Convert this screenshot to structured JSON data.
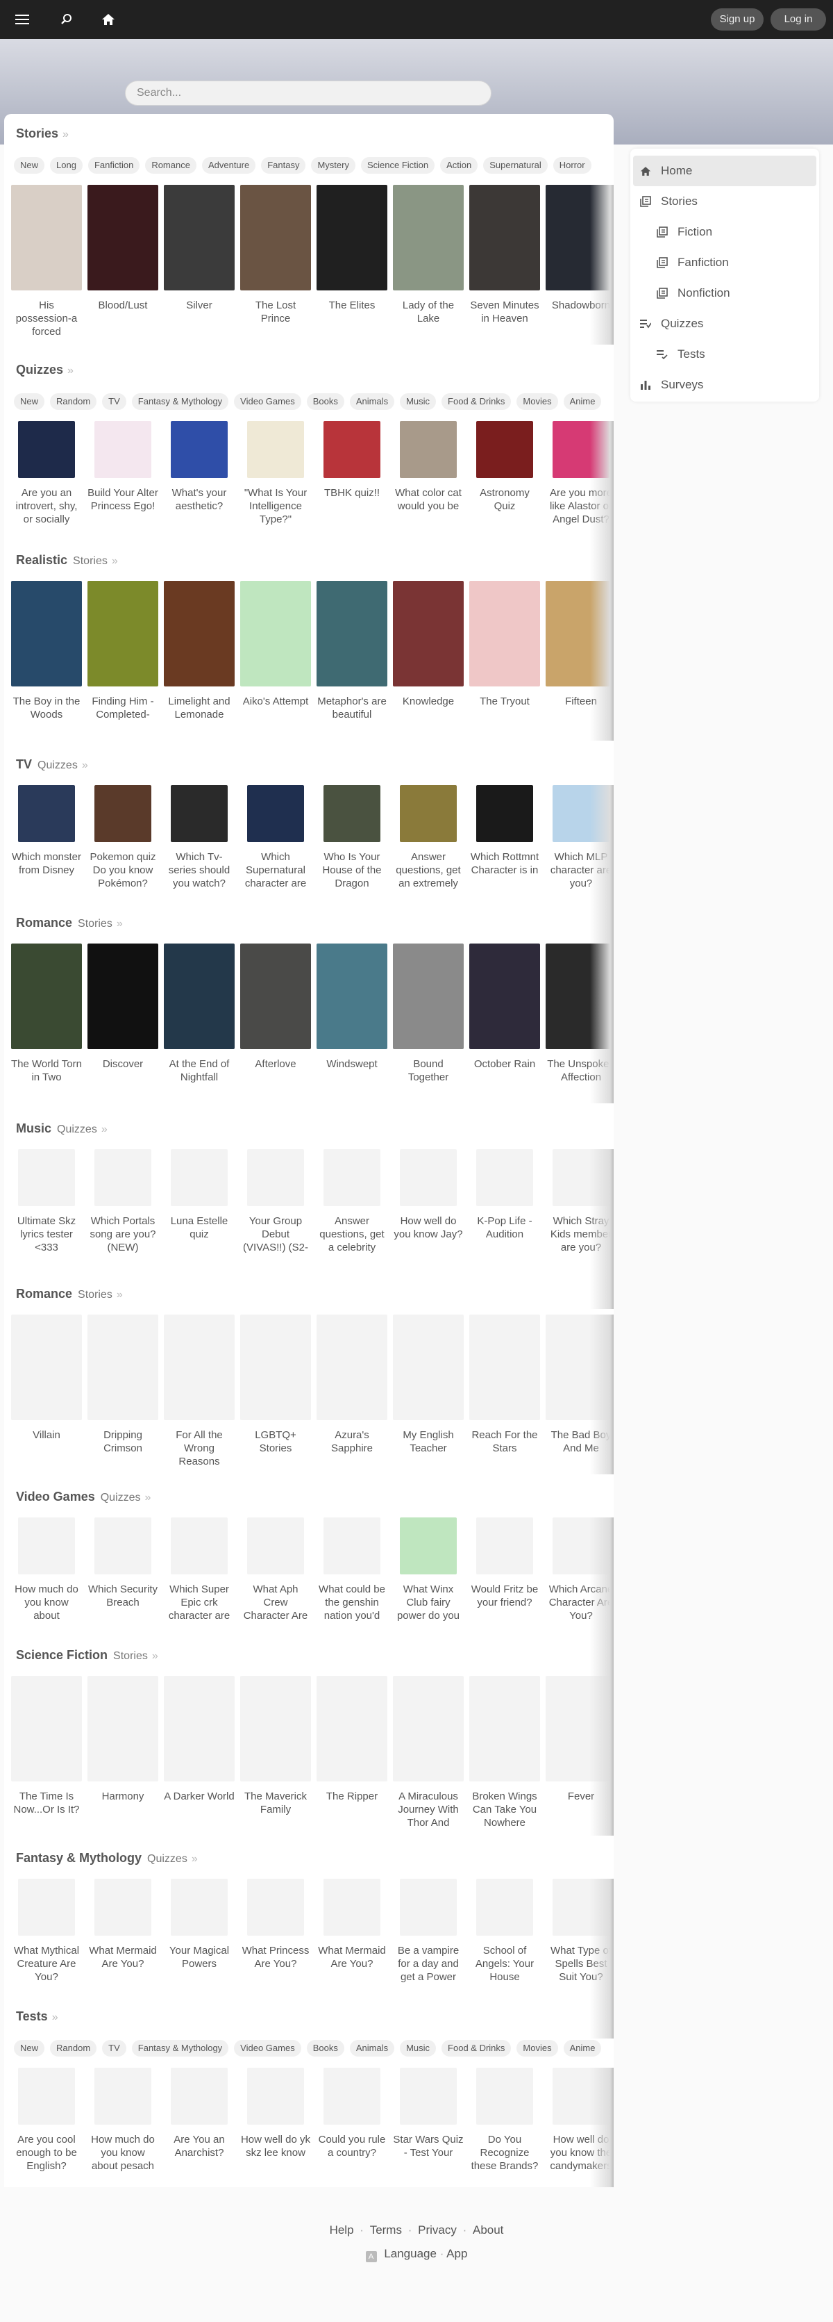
{
  "topbar": {
    "menu_icon": "hamburger-menu-icon",
    "search_icon": "search-icon",
    "home_icon": "home-icon",
    "signup_label": "Sign up",
    "login_label": "Log in"
  },
  "search": {
    "placeholder": "Search..."
  },
  "sections": [
    {
      "title": "Stories",
      "sub": "",
      "kind": "story",
      "chips": [
        "New",
        "Long",
        "Fanfiction",
        "Romance",
        "Adventure",
        "Fantasy",
        "Mystery",
        "Science Fiction",
        "Action",
        "Supernatural",
        "Horror"
      ],
      "items": [
        {
          "title": "His possession-a forced",
          "color": "#d9cfc6"
        },
        {
          "title": "Blood/Lust",
          "color": "#3a1a1d"
        },
        {
          "title": "Silver",
          "color": "#3b3b3b"
        },
        {
          "title": "The Lost Prince",
          "color": "#6a5443"
        },
        {
          "title": "The Elites",
          "color": "#202020"
        },
        {
          "title": "Lady of the Lake",
          "color": "#8a9684"
        },
        {
          "title": "Seven Minutes in Heaven",
          "color": "#3c3836"
        },
        {
          "title": "Shadowborn",
          "color": "#262a33"
        }
      ]
    },
    {
      "title": "Quizzes",
      "sub": "",
      "kind": "quiz",
      "chips": [
        "New",
        "Random",
        "TV",
        "Fantasy & Mythology",
        "Video Games",
        "Books",
        "Animals",
        "Music",
        "Food & Drinks",
        "Movies",
        "Anime"
      ],
      "items": [
        {
          "title": "Are you an introvert, shy, or socially",
          "color": "#1e2a4a"
        },
        {
          "title": "Build Your Alter Princess Ego!",
          "color": "#f4e7ef"
        },
        {
          "title": "What's your aesthetic?",
          "color": "#2f4ea8"
        },
        {
          "title": "\"What Is Your Intelligence Type?\"",
          "color": "#efe9d6"
        },
        {
          "title": "TBHK quiz!!",
          "color": "#b8343a"
        },
        {
          "title": "What color cat would you be",
          "color": "#a89a8a"
        },
        {
          "title": "Astronomy Quiz",
          "color": "#7a1e1e"
        },
        {
          "title": "Are you more like Alastor or Angel Dust?",
          "color": "#d63a74"
        }
      ]
    },
    {
      "title": "Realistic",
      "sub": "Stories",
      "kind": "story",
      "chips": [],
      "items": [
        {
          "title": "The Boy in the Woods",
          "color": "#274a6a"
        },
        {
          "title": "Finding Him - Completed-",
          "color": "#7c8a2a"
        },
        {
          "title": "Limelight and Lemonade",
          "color": "#6a3a22"
        },
        {
          "title": "Aiko's Attempt",
          "color": "#bfe6bf"
        },
        {
          "title": "Metaphor's are beautiful",
          "color": "#3f6a72"
        },
        {
          "title": "Knowledge",
          "color": "#7a3434"
        },
        {
          "title": "The Tryout",
          "color": "#efc7c7"
        },
        {
          "title": "Fifteen",
          "color": "#c9a46a"
        }
      ]
    },
    {
      "title": "TV",
      "sub": "Quizzes",
      "kind": "quiz",
      "chips": [],
      "items": [
        {
          "title": "Which monster from Disney",
          "color": "#2a3a5a"
        },
        {
          "title": "Pokemon quiz Do you know Pokémon?",
          "color": "#5a3a2a"
        },
        {
          "title": "Which Tv-series should you watch?",
          "color": "#2a2a2a"
        },
        {
          "title": "Which Supernatural character are",
          "color": "#1f2f4f"
        },
        {
          "title": "Who Is Your House of the Dragon",
          "color": "#4a5240"
        },
        {
          "title": "Answer questions, get an extremely",
          "color": "#8a7a3a"
        },
        {
          "title": "Which Rottmnt Character is in",
          "color": "#1a1a1a"
        },
        {
          "title": "Which MLP character are you?",
          "color": "#b8d4ea"
        }
      ]
    },
    {
      "title": "Romance",
      "sub": "Stories",
      "kind": "story",
      "chips": [],
      "items": [
        {
          "title": "The World Torn in Two",
          "color": "#3a4a32"
        },
        {
          "title": "Discover",
          "color": "#111111"
        },
        {
          "title": "At the End of Nightfall",
          "color": "#23384a"
        },
        {
          "title": "Afterlove",
          "color": "#4a4a48"
        },
        {
          "title": "Windswept",
          "color": "#4a7a8a"
        },
        {
          "title": "Bound Together",
          "color": "#8a8a8a"
        },
        {
          "title": "October Rain",
          "color": "#2e2a3a"
        },
        {
          "title": "The Unspoken Affection",
          "color": "#2a2a2a"
        }
      ]
    },
    {
      "title": "Music",
      "sub": "Quizzes",
      "kind": "quiz",
      "chips": [],
      "items": [
        {
          "title": "Ultimate Skz lyrics tester <333",
          "color": ""
        },
        {
          "title": "Which Portals song are you? (NEW)",
          "color": ""
        },
        {
          "title": "Luna Estelle quiz",
          "color": ""
        },
        {
          "title": "Your Group Debut (VIVAS!!) (S2-",
          "color": ""
        },
        {
          "title": "Answer questions, get a celebrity",
          "color": ""
        },
        {
          "title": "How well do you know Jay?",
          "color": ""
        },
        {
          "title": "K-Pop Life - Audition",
          "color": ""
        },
        {
          "title": "Which Stray Kids member are you?",
          "color": ""
        }
      ]
    },
    {
      "title": "Romance",
      "sub": "Stories",
      "kind": "story",
      "chips": [],
      "items": [
        {
          "title": "Villain",
          "color": ""
        },
        {
          "title": "Dripping Crimson",
          "color": ""
        },
        {
          "title": "For All the Wrong Reasons",
          "color": ""
        },
        {
          "title": "LGBTQ+ Stories",
          "color": ""
        },
        {
          "title": "Azura's Sapphire",
          "color": ""
        },
        {
          "title": "My English Teacher",
          "color": ""
        },
        {
          "title": "Reach For the Stars",
          "color": ""
        },
        {
          "title": "The Bad Boy And Me",
          "color": ""
        }
      ]
    },
    {
      "title": "Video Games",
      "sub": "Quizzes",
      "kind": "quiz",
      "chips": [],
      "items": [
        {
          "title": "How much do you know about",
          "color": ""
        },
        {
          "title": "Which Security Breach",
          "color": ""
        },
        {
          "title": "Which Super Epic crk character are",
          "color": ""
        },
        {
          "title": "What Aph Crew Character Are",
          "color": ""
        },
        {
          "title": "What could be the genshin nation you'd",
          "color": ""
        },
        {
          "title": "What Winx Club fairy power do you",
          "color": "#bfe6bf"
        },
        {
          "title": "Would Fritz be your friend?",
          "color": ""
        },
        {
          "title": "Which Arcane Character Are You?",
          "color": ""
        }
      ]
    },
    {
      "title": "Science Fiction",
      "sub": "Stories",
      "kind": "story",
      "chips": [],
      "items": [
        {
          "title": "The Time Is Now...Or Is It?",
          "color": ""
        },
        {
          "title": "Harmony",
          "color": ""
        },
        {
          "title": "A Darker World",
          "color": ""
        },
        {
          "title": "The Maverick Family",
          "color": ""
        },
        {
          "title": "The Ripper",
          "color": ""
        },
        {
          "title": "A Miraculous Journey With Thor And",
          "color": ""
        },
        {
          "title": "Broken Wings Can Take You Nowhere",
          "color": ""
        },
        {
          "title": "Fever",
          "color": ""
        }
      ]
    },
    {
      "title": "Fantasy & Mythology",
      "sub": "Quizzes",
      "kind": "quiz",
      "chips": [],
      "items": [
        {
          "title": "What Mythical Creature Are You?",
          "color": ""
        },
        {
          "title": "What Mermaid Are You?",
          "color": ""
        },
        {
          "title": "Your Magical Powers",
          "color": ""
        },
        {
          "title": "What Princess Are You?",
          "color": ""
        },
        {
          "title": "What Mermaid Are You?",
          "color": ""
        },
        {
          "title": "Be a vampire for a day and get a Power",
          "color": ""
        },
        {
          "title": "School of Angels: Your House",
          "color": ""
        },
        {
          "title": "What Type of Spells Best Suit You?",
          "color": ""
        }
      ]
    },
    {
      "title": "Tests",
      "sub": "",
      "kind": "quiz",
      "chips": [
        "New",
        "Random",
        "TV",
        "Fantasy & Mythology",
        "Video Games",
        "Books",
        "Animals",
        "Music",
        "Food & Drinks",
        "Movies",
        "Anime"
      ],
      "items": [
        {
          "title": "Are you cool enough to be English?",
          "color": ""
        },
        {
          "title": "How much do you know about pesach",
          "color": ""
        },
        {
          "title": "Are You an Anarchist?",
          "color": ""
        },
        {
          "title": "How well do yk skz lee know",
          "color": ""
        },
        {
          "title": "Could you rule a country?",
          "color": ""
        },
        {
          "title": "Star Wars Quiz - Test Your",
          "color": ""
        },
        {
          "title": "Do You Recognize these Brands?",
          "color": ""
        },
        {
          "title": "How well do you know the candymakers",
          "color": ""
        }
      ]
    }
  ],
  "sidebar": {
    "items": [
      {
        "label": "Home",
        "icon": "home-icon",
        "indent": false,
        "active": true
      },
      {
        "label": "Stories",
        "icon": "book-stack-icon",
        "indent": false,
        "active": false
      },
      {
        "label": "Fiction",
        "icon": "book-stack-icon",
        "indent": true,
        "active": false
      },
      {
        "label": "Fanfiction",
        "icon": "book-stack-icon",
        "indent": true,
        "active": false
      },
      {
        "label": "Nonfiction",
        "icon": "book-stack-icon",
        "indent": true,
        "active": false
      },
      {
        "label": "Quizzes",
        "icon": "quiz-list-icon",
        "indent": false,
        "active": false
      },
      {
        "label": "Tests",
        "icon": "checklist-icon",
        "indent": true,
        "active": false
      },
      {
        "label": "Surveys",
        "icon": "bar-chart-icon",
        "indent": false,
        "active": false
      }
    ]
  },
  "footer": {
    "help": "Help",
    "terms": "Terms",
    "privacy": "Privacy",
    "about": "About",
    "language": "Language",
    "app": "App",
    "language_icon": "translate-icon"
  }
}
